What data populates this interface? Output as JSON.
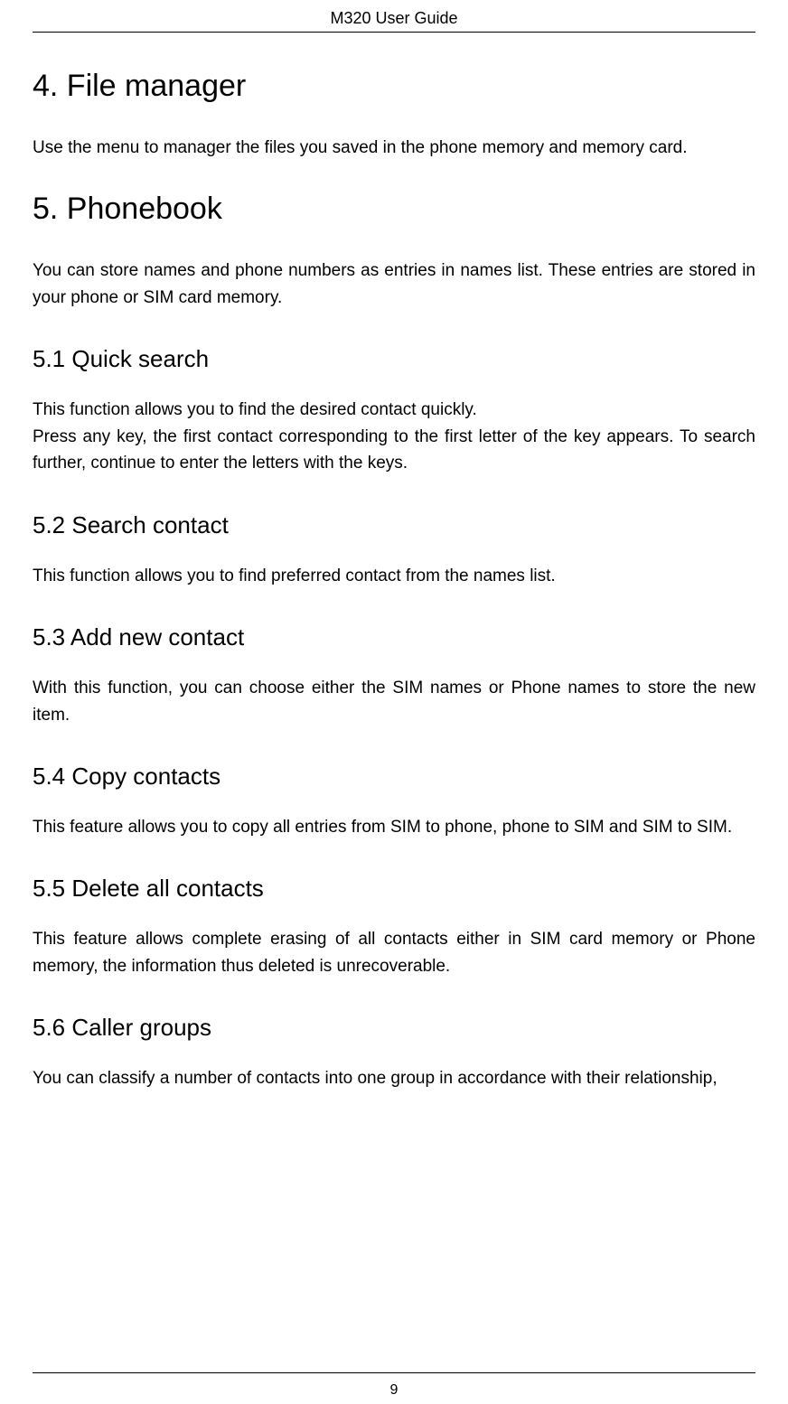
{
  "header": {
    "title": "M320 User Guide"
  },
  "sections": {
    "s4": {
      "heading": "4. File manager",
      "body": "Use the menu to manager the files you saved in the phone memory and memory card."
    },
    "s5": {
      "heading": "5. Phonebook",
      "body": "You can store names and phone numbers as entries in names list. These entries are stored in your phone or SIM card memory."
    },
    "s5_1": {
      "heading": "5.1 Quick search",
      "body1": "This function allows you to find the desired contact quickly.",
      "body2": "Press any key, the first contact corresponding to the first letter of the key appears. To search further, continue to enter the letters with the keys."
    },
    "s5_2": {
      "heading": "5.2 Search contact",
      "body": "This function allows you to find preferred contact from the names list."
    },
    "s5_3": {
      "heading": "5.3 Add new contact",
      "body": "With this function, you can choose either the SIM names or Phone names to store the new item."
    },
    "s5_4": {
      "heading": "5.4 Copy contacts",
      "body": "This feature allows you to copy all entries from SIM to phone, phone to SIM and SIM to SIM."
    },
    "s5_5": {
      "heading": "5.5 Delete all contacts",
      "body": "This feature allows complete erasing of all contacts either in SIM card memory or Phone memory, the information thus deleted is unrecoverable."
    },
    "s5_6": {
      "heading": "5.6 Caller groups",
      "body": "You can classify a number of contacts into one group in accordance with their relationship,"
    }
  },
  "page_number": "9"
}
